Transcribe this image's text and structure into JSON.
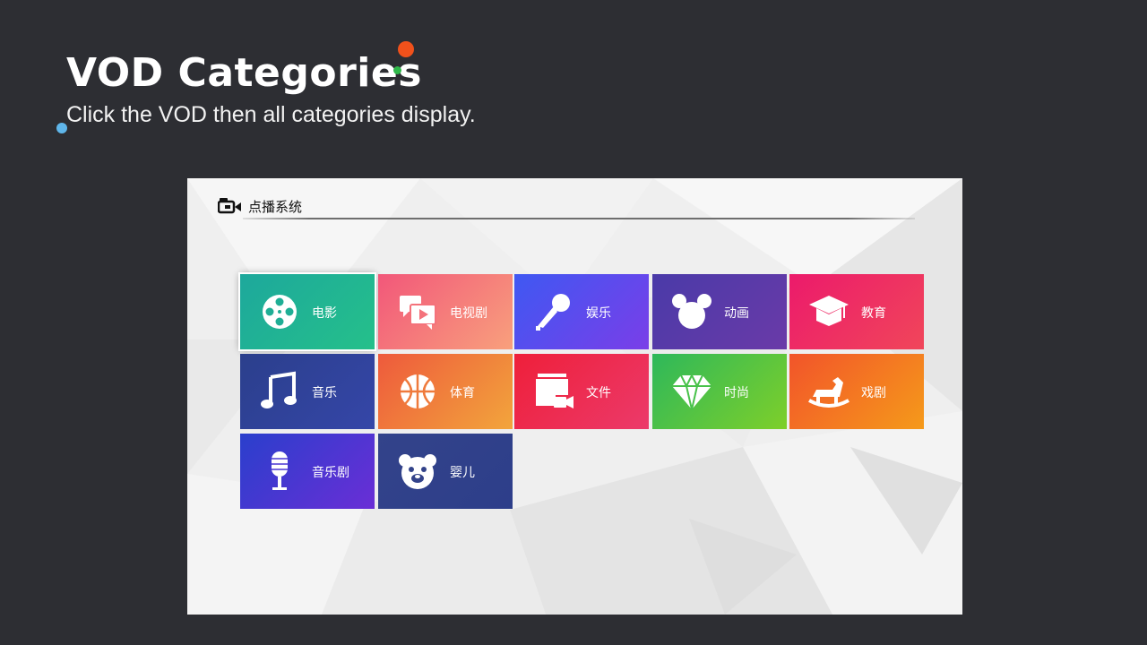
{
  "slide": {
    "title": "VOD Categories",
    "subtitle": "Click the VOD then all categories display."
  },
  "screen": {
    "header_icon": "video-camera-icon",
    "title": "点播系统",
    "selected_index": 0
  },
  "tiles": [
    {
      "label": "电影",
      "icon": "film-reel-icon",
      "colors": [
        "#1da89c",
        "#25c08a"
      ]
    },
    {
      "label": "电视剧",
      "icon": "chat-video-icon",
      "colors": [
        "#f2577a",
        "#f8a07c"
      ]
    },
    {
      "label": "娱乐",
      "icon": "microphone-icon",
      "colors": [
        "#3f58f2",
        "#7a3ee8"
      ]
    },
    {
      "label": "动画",
      "icon": "mickey-head-icon",
      "colors": [
        "#4a3aa8",
        "#6a3aa8"
      ]
    },
    {
      "label": "教育",
      "icon": "graduation-cap-icon",
      "colors": [
        "#ec1a6b",
        "#f0465a"
      ]
    },
    {
      "label": "音乐",
      "icon": "music-note-icon",
      "colors": [
        "#2b3f8c",
        "#3546a8"
      ]
    },
    {
      "label": "体育",
      "icon": "basketball-icon",
      "colors": [
        "#ee5a3c",
        "#f2a53c"
      ]
    },
    {
      "label": "文件",
      "icon": "files-video-icon",
      "colors": [
        "#ee1f3a",
        "#ec3a6a"
      ]
    },
    {
      "label": "时尚",
      "icon": "diamond-icon",
      "colors": [
        "#2eb85a",
        "#7ecf2a"
      ]
    },
    {
      "label": "戏剧",
      "icon": "rocking-horse-icon",
      "colors": [
        "#f2542a",
        "#f59a1a"
      ]
    },
    {
      "label": "音乐剧",
      "icon": "studio-mic-icon",
      "colors": [
        "#2a3fcc",
        "#6a2ed6"
      ]
    },
    {
      "label": "婴儿",
      "icon": "teddy-bear-icon",
      "colors": [
        "#33438a",
        "#2d3e8a"
      ]
    }
  ]
}
